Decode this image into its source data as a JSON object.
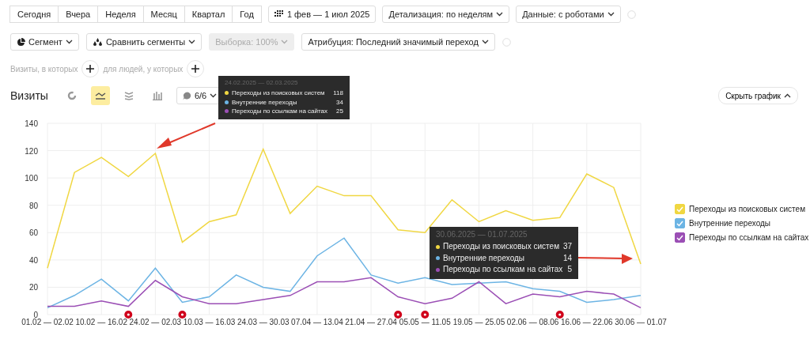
{
  "toolbar": {
    "periods": [
      "Сегодня",
      "Вчера",
      "Неделя",
      "Месяц",
      "Квартал",
      "Год"
    ],
    "date_range": "1 фев — 1 июл 2025",
    "detail": "Детализация: по неделям",
    "data_filter": "Данные: с роботами"
  },
  "segment_bar": {
    "segment": "Сегмент",
    "compare": "Сравнить сегменты",
    "sample": {
      "label": "Выборка: 100%",
      "disabled": true
    },
    "attribution": "Атрибуция: Последний значимый переход"
  },
  "conditions": {
    "visits_label": "Визиты, в которых",
    "people_label": "для людей, у которых"
  },
  "report": {
    "title": "Визиты",
    "chart_types": [
      {
        "kind": "pie",
        "selected": false
      },
      {
        "kind": "line",
        "selected": true
      },
      {
        "kind": "area",
        "selected": false
      },
      {
        "kind": "bar",
        "selected": false
      }
    ],
    "annotations_filter": "6/6",
    "hide_chart": "Скрыть график"
  },
  "chart": {
    "chart_data": {
      "type": "line",
      "categories": [
        "01.02 — 02.02",
        null,
        "10.02 — 16.02",
        null,
        "24.02 — 02.03",
        null,
        "10.03 — 16.03",
        null,
        "24.03 — 30.03",
        null,
        "07.04 — 13.04",
        null,
        "21.04 — 27.04",
        null,
        "05.05 — 11.05",
        null,
        "19.05 — 25.05",
        null,
        "02.06 — 08.06",
        null,
        "16.06 — 22.06",
        null,
        "30.06 — 01.07"
      ],
      "series": [
        {
          "name": "Переходы из поисковых систем",
          "color": "#f0d742",
          "values": [
            34,
            104,
            115,
            101,
            118,
            53,
            68,
            73,
            121,
            74,
            94,
            87,
            87,
            62,
            60,
            84,
            68,
            76,
            69,
            71,
            103,
            93,
            37
          ]
        },
        {
          "name": "Внутренние переходы",
          "color": "#6cb4e4",
          "values": [
            5,
            14,
            26,
            10,
            34,
            9,
            13,
            29,
            20,
            17,
            43,
            56,
            29,
            23,
            27,
            22,
            23,
            24,
            19,
            17,
            9,
            11,
            14
          ]
        },
        {
          "name": "Переходы по ссылкам на сайтах",
          "color": "#9b4fb5",
          "values": [
            6,
            6,
            10,
            6,
            25,
            13,
            8,
            8,
            11,
            14,
            24,
            24,
            27,
            13,
            8,
            12,
            24,
            8,
            15,
            13,
            17,
            15,
            5
          ]
        }
      ],
      "ylim": [
        0,
        140
      ],
      "yticks": [
        0,
        20,
        40,
        60,
        80,
        100,
        120,
        140
      ],
      "grid": true,
      "legend": true
    },
    "tooltips": [
      {
        "date": "24.02.2025 — 02.03.2025",
        "rows": [
          {
            "label": "Переходы из поисковых систем",
            "value": "118",
            "color": "#f0d742"
          },
          {
            "label": "Внутренние переходы",
            "value": "34",
            "color": "#6cb4e4"
          },
          {
            "label": "Переходы по ссылкам на сайтах",
            "value": "25",
            "color": "#9b4fb5"
          }
        ]
      },
      {
        "date": "30.06.2025 — 01.07.2025",
        "rows": [
          {
            "label": "Переходы из поисковых систем",
            "value": "37",
            "color": "#f0d742"
          },
          {
            "label": "Внутренние переходы",
            "value": "14",
            "color": "#6cb4e4"
          },
          {
            "label": "Переходы по ссылкам на сайтах",
            "value": "5",
            "color": "#9b4fb5"
          }
        ]
      }
    ],
    "legend": [
      {
        "checked": true
      },
      {
        "checked": true
      },
      {
        "checked": true
      }
    ]
  }
}
